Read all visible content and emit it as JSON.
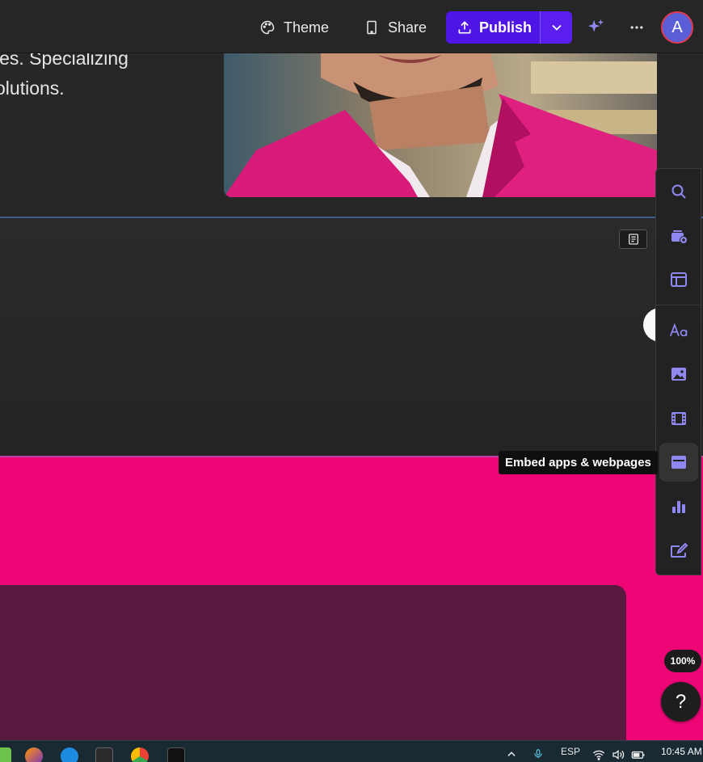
{
  "toolbar": {
    "theme_label": "Theme",
    "share_label": "Share",
    "publish_label": "Publish",
    "avatar_initial": "A"
  },
  "hero": {
    "text_lines": [
      "ies. Specializing",
      "olutions."
    ]
  },
  "rail": {
    "items": [
      {
        "name": "search",
        "icon": "search-icon"
      },
      {
        "name": "add-card",
        "icon": "add-card-icon"
      },
      {
        "name": "layout",
        "icon": "layout-icon"
      },
      {
        "name": "text",
        "icon": "text-icon"
      },
      {
        "name": "image",
        "icon": "image-icon"
      },
      {
        "name": "video",
        "icon": "video-icon"
      },
      {
        "name": "embed",
        "icon": "embed-icon"
      },
      {
        "name": "chart",
        "icon": "chart-icon"
      },
      {
        "name": "form",
        "icon": "form-icon"
      }
    ],
    "active": "embed"
  },
  "tooltip": {
    "text": "Embed apps & webpages"
  },
  "zoom": {
    "label": "100%"
  },
  "help": {
    "label": "?"
  },
  "taskbar": {
    "language": "ESP",
    "time": "10:45 AM"
  },
  "colors": {
    "accent": "#4f14e6",
    "icon": "#8f88f0",
    "pink": "#ee0676",
    "card": "#5a193f"
  }
}
